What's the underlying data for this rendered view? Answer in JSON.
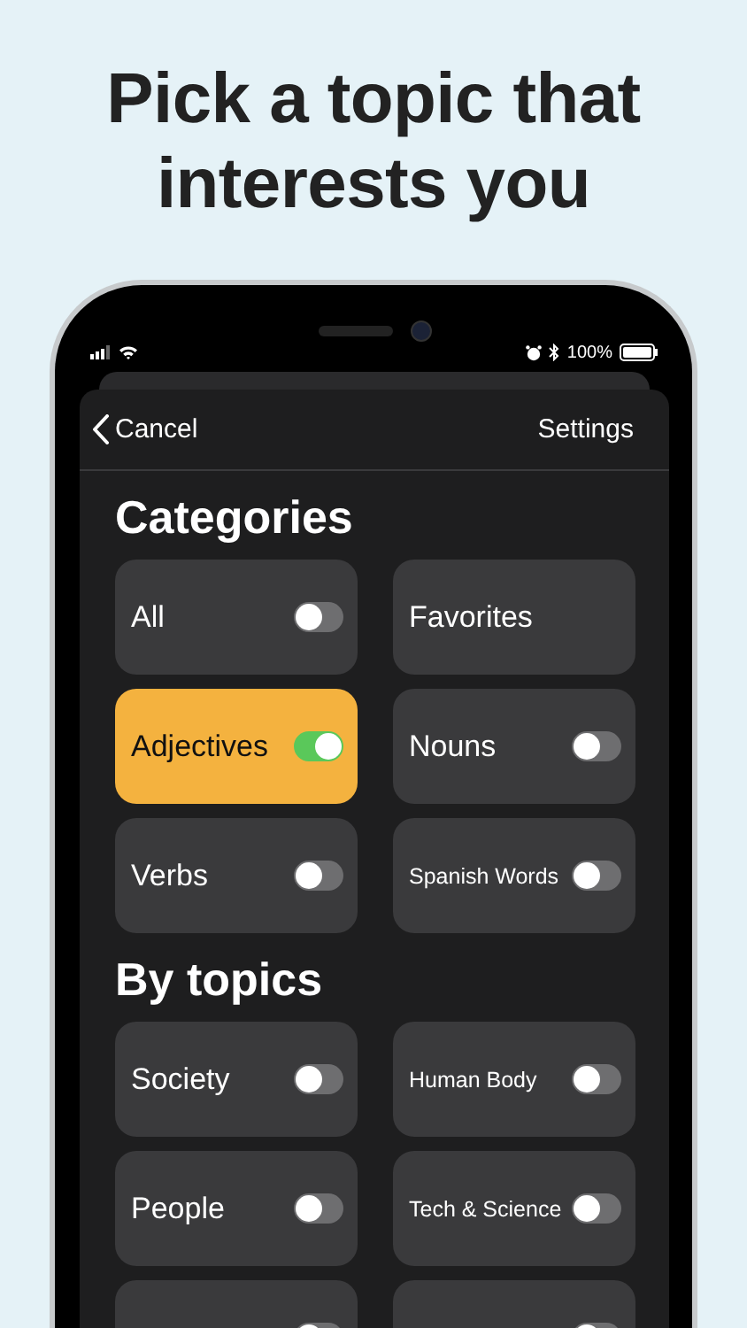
{
  "headline": "Pick a topic that interests you",
  "status_bar": {
    "battery": "100%"
  },
  "nav": {
    "back": "Cancel",
    "title": "Settings"
  },
  "sections": [
    {
      "title": "Categories",
      "items": [
        {
          "kind": "toggle",
          "label": "All",
          "on": false
        },
        {
          "kind": "link",
          "label": "Favorites"
        },
        {
          "kind": "toggle",
          "label": "Adjectives",
          "on": true
        },
        {
          "kind": "toggle",
          "label": "Nouns",
          "on": false
        },
        {
          "kind": "toggle",
          "label": "Verbs",
          "on": false
        },
        {
          "kind": "toggle",
          "label": "Spanish Words",
          "on": false
        }
      ]
    },
    {
      "title": "By topics",
      "items": [
        {
          "kind": "toggle",
          "label": "Society",
          "on": false
        },
        {
          "kind": "toggle",
          "label": "Human Body",
          "on": false
        },
        {
          "kind": "toggle",
          "label": "People",
          "on": false
        },
        {
          "kind": "toggle",
          "label": "Tech & Science",
          "on": false
        },
        {
          "kind": "toggle",
          "on": false
        },
        {
          "kind": "toggle",
          "on": false
        }
      ]
    }
  ]
}
